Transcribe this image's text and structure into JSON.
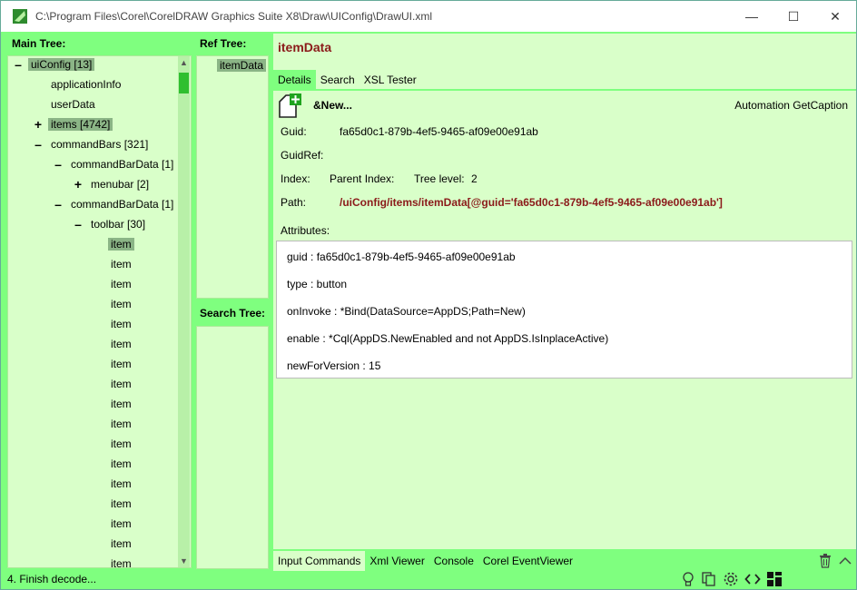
{
  "window": {
    "title": "C:\\Program Files\\Corel\\CorelDRAW Graphics Suite X8\\Draw\\UIConfig\\DrawUI.xml",
    "min_glyph": "—",
    "max_glyph": "☐",
    "close_glyph": "✕"
  },
  "main_tree": {
    "header": "Main Tree:",
    "rows": [
      {
        "label": "uiConfig [13]",
        "toggle": "–"
      },
      {
        "label": "applicationInfo",
        "toggle": ""
      },
      {
        "label": "userData",
        "toggle": ""
      },
      {
        "label": "items [4742]",
        "toggle": "+"
      },
      {
        "label": "commandBars [321]",
        "toggle": "–"
      },
      {
        "label": "commandBarData [1]",
        "toggle": "–"
      },
      {
        "label": "menubar [2]",
        "toggle": "+"
      },
      {
        "label": "commandBarData [1]",
        "toggle": "–"
      },
      {
        "label": "toolbar [30]",
        "toggle": "–"
      },
      {
        "label": "item",
        "toggle": ""
      },
      {
        "label": "item",
        "toggle": ""
      },
      {
        "label": "item",
        "toggle": ""
      },
      {
        "label": "item",
        "toggle": ""
      },
      {
        "label": "item",
        "toggle": ""
      },
      {
        "label": "item",
        "toggle": ""
      },
      {
        "label": "item",
        "toggle": ""
      },
      {
        "label": "item",
        "toggle": ""
      },
      {
        "label": "item",
        "toggle": ""
      },
      {
        "label": "item",
        "toggle": ""
      },
      {
        "label": "item",
        "toggle": ""
      },
      {
        "label": "item",
        "toggle": ""
      },
      {
        "label": "item",
        "toggle": ""
      },
      {
        "label": "item",
        "toggle": ""
      },
      {
        "label": "item",
        "toggle": ""
      },
      {
        "label": "item",
        "toggle": ""
      },
      {
        "label": "item",
        "toggle": ""
      },
      {
        "label": "item",
        "toggle": ""
      }
    ]
  },
  "ref_tree": {
    "header": "Ref Tree:",
    "item": "itemData"
  },
  "search_tree": {
    "header": "Search Tree:"
  },
  "detail": {
    "title": "itemData",
    "tabs": [
      "Details",
      "Search",
      "XSL Tester"
    ],
    "caption": "&New...",
    "automation_label": "Automation GetCaption",
    "guid_label": "Guid:",
    "guid_value": "fa65d0c1-879b-4ef5-9465-af09e00e91ab",
    "guidref_label": "GuidRef:",
    "index_label": "Index:",
    "parent_index_label": "Parent Index:",
    "tree_level_label": "Tree level:",
    "tree_level_value": "2",
    "path_label": "Path:",
    "path_value": "/uiConfig/items/itemData[@guid='fa65d0c1-879b-4ef5-9465-af09e00e91ab']",
    "attributes_label": "Attributes:",
    "attributes": [
      "guid  :  fa65d0c1-879b-4ef5-9465-af09e00e91ab",
      "type  :  button",
      "onInvoke  :  *Bind(DataSource=AppDS;Path=New)",
      "enable  :  *Cql(AppDS.NewEnabled and not AppDS.IsInplaceActive)",
      "newForVersion  :  15"
    ]
  },
  "bottom_tabs": [
    "Input Commands",
    "Xml Viewer",
    "Console",
    "Corel EventViewer"
  ],
  "status": {
    "text": "4. Finish decode..."
  }
}
